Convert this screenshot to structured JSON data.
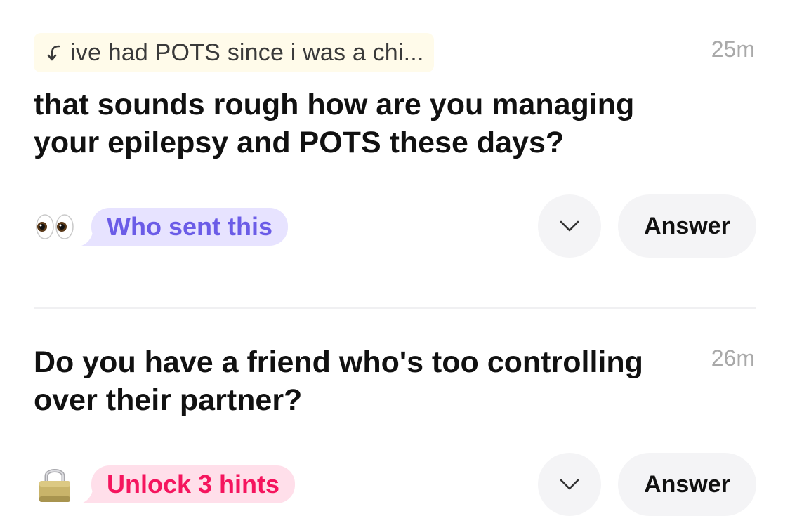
{
  "questions": [
    {
      "reply_preview": "ive had POTS since i was a chi...",
      "timestamp": "25m",
      "text": "that sounds rough how are you managing your epilepsy and POTS these days?",
      "hint_icon": "eyes-emoji-icon",
      "hint_label": "Who sent this",
      "hint_color": "#6b5ce7",
      "answer_label": "Answer"
    },
    {
      "timestamp": "26m",
      "text": "Do you have a friend who's too controlling over their partner?",
      "hint_icon": "lock-emoji-icon",
      "hint_label": "Unlock 3 hints",
      "hint_color": "#f5155e",
      "answer_label": "Answer"
    }
  ]
}
